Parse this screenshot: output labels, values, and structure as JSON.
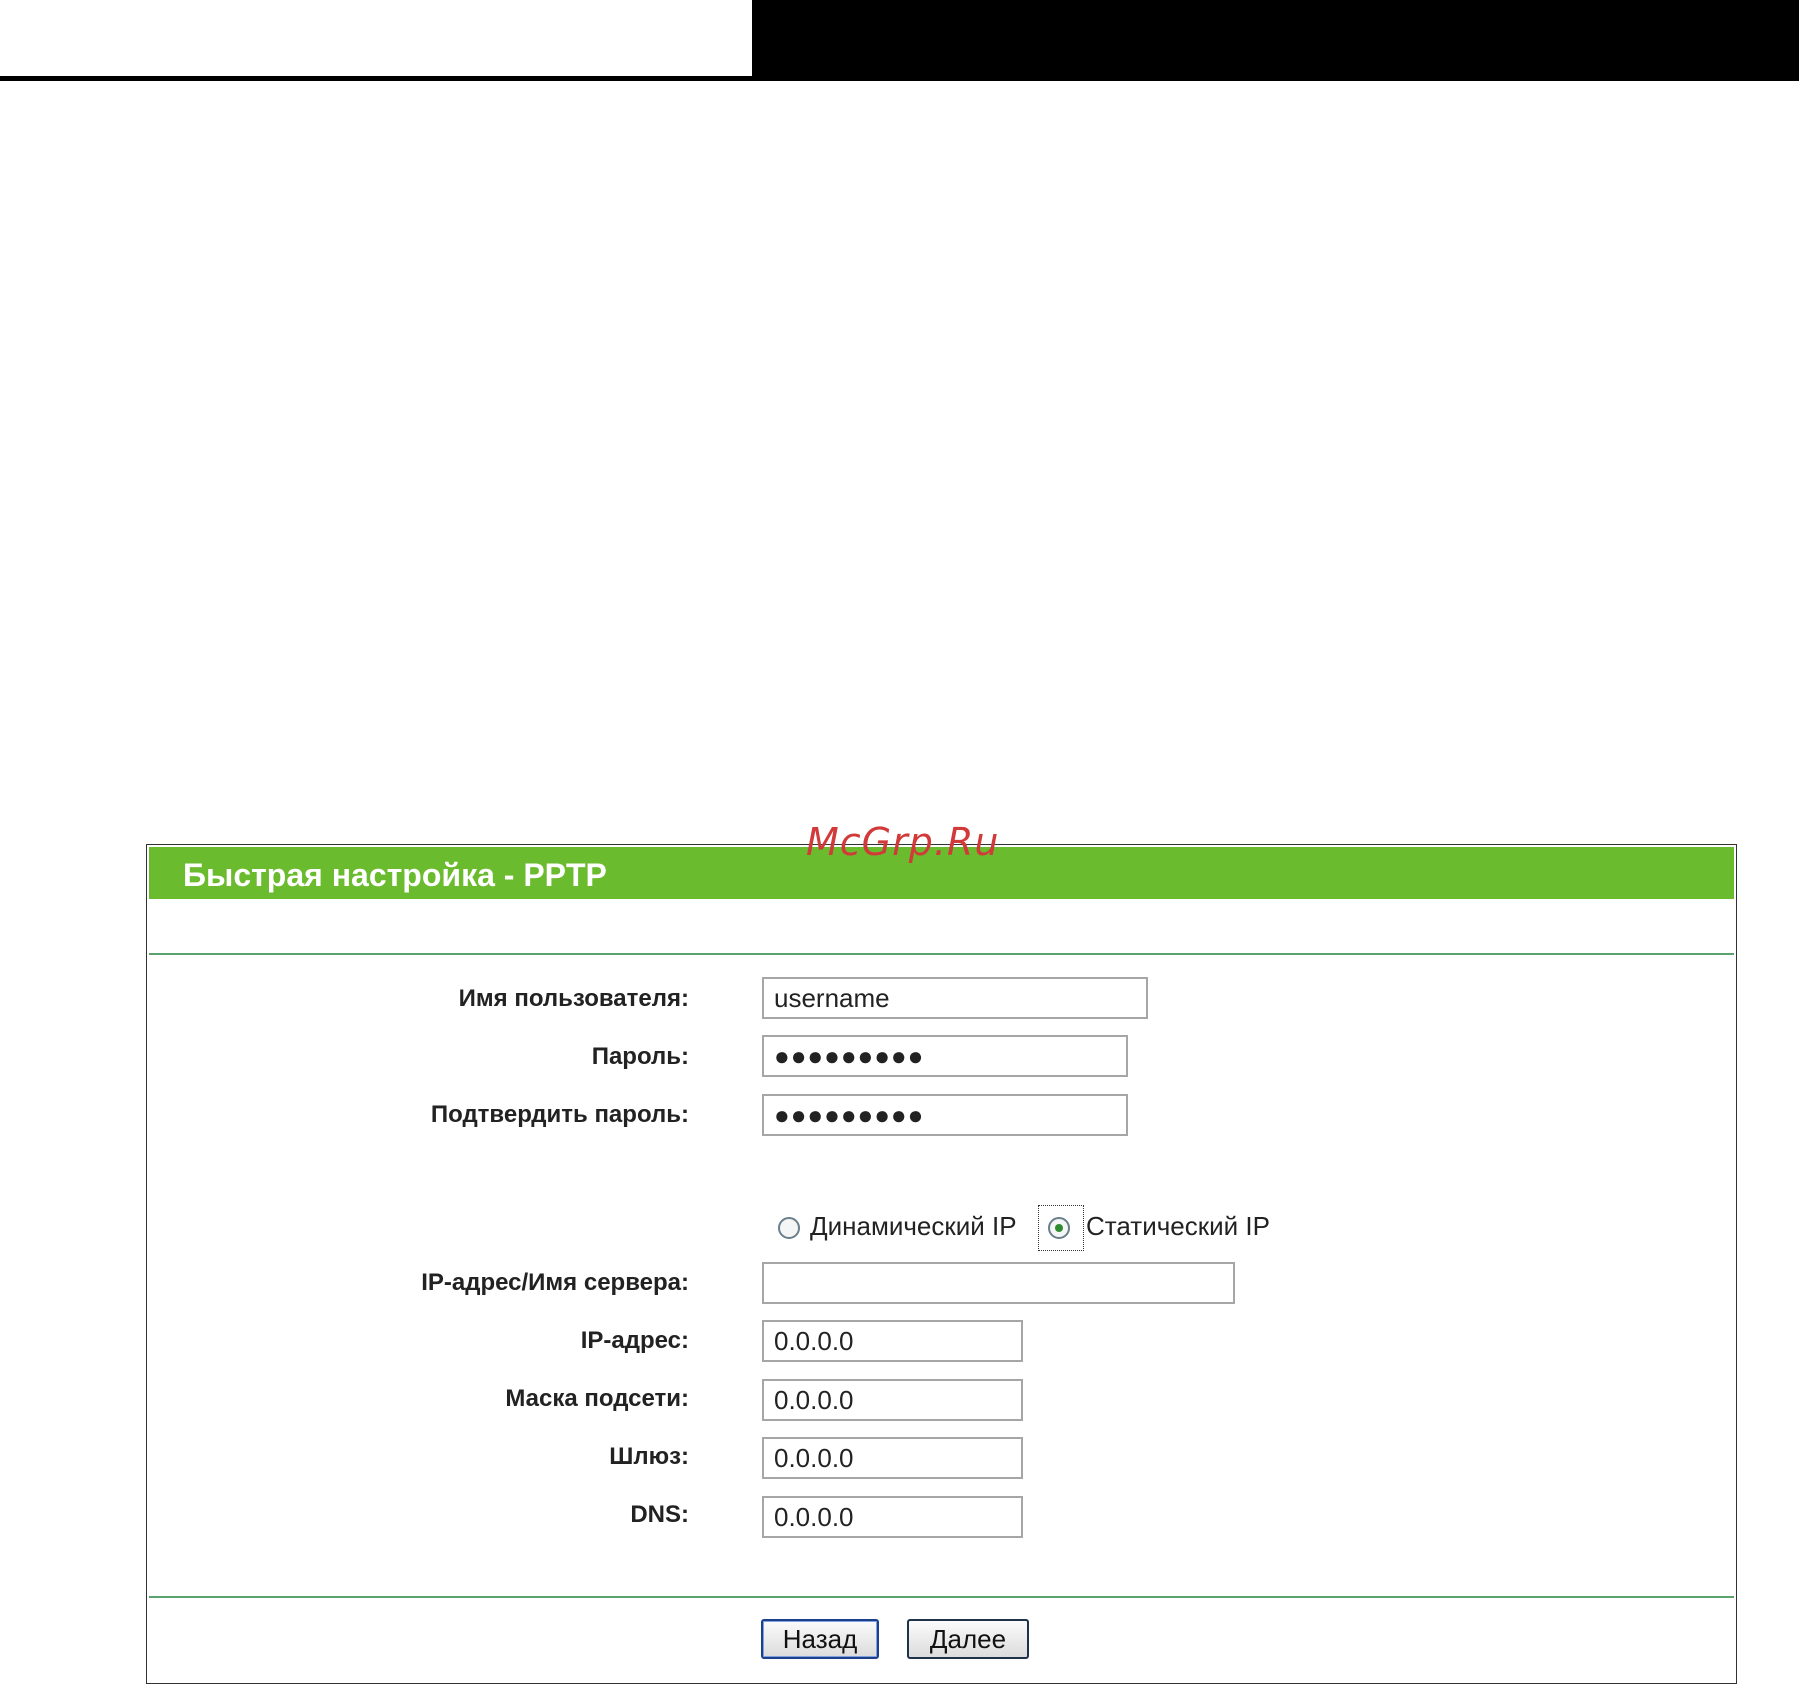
{
  "watermark": "McGrp.Ru",
  "title": "Быстрая настройка - PPTP",
  "fields": {
    "username": {
      "label": "Имя пользователя:",
      "value": "username"
    },
    "password": {
      "label": "Пароль:",
      "value": "●●●●●●●●●"
    },
    "confirm_password": {
      "label": "Подтвердить пароль:",
      "value": "●●●●●●●●●"
    },
    "server": {
      "label": "IP-адрес/Имя сервера:",
      "value": ""
    },
    "ip": {
      "label": "IP-адрес:",
      "value": "0.0.0.0"
    },
    "mask": {
      "label": "Маска подсети:",
      "value": "0.0.0.0"
    },
    "gateway": {
      "label": "Шлюз:",
      "value": "0.0.0.0"
    },
    "dns": {
      "label": "DNS:",
      "value": "0.0.0.0"
    }
  },
  "ip_mode": {
    "dynamic_label": "Динамический IP",
    "static_label": "Статический IP",
    "selected": "static"
  },
  "buttons": {
    "back": "Назад",
    "next": "Далее"
  },
  "colors": {
    "header": "#6bbb2e",
    "rule": "#5aa36f"
  }
}
